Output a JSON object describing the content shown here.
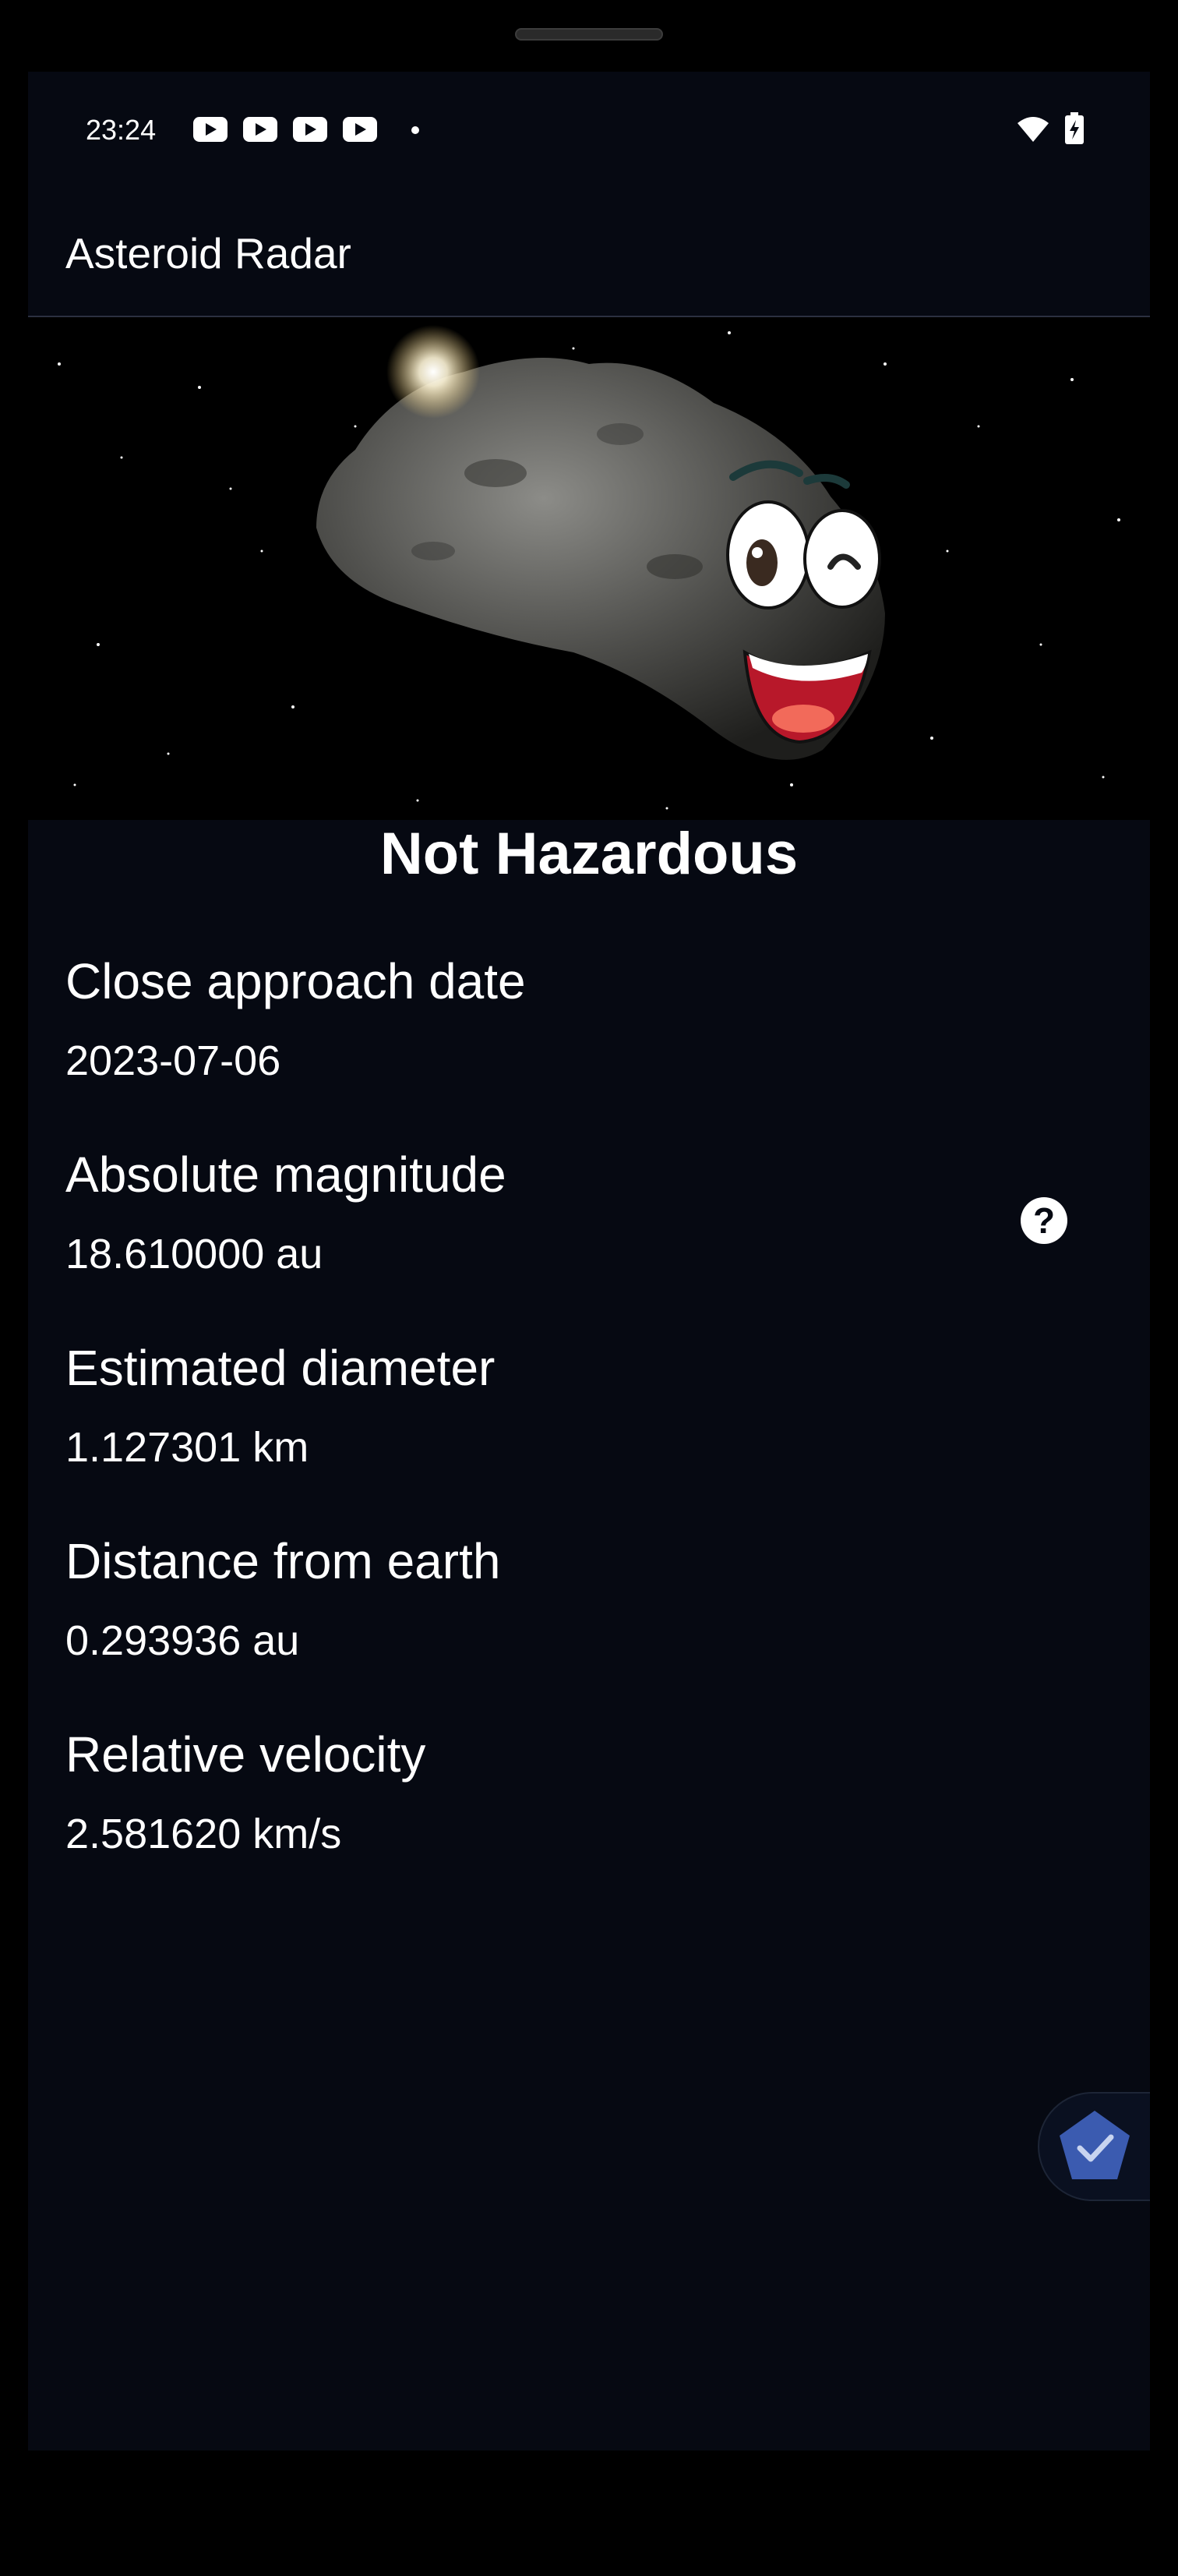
{
  "status": {
    "time": "23:24"
  },
  "appbar": {
    "title": "Asteroid Radar"
  },
  "hero": {
    "image": "smiling-asteroid-in-space"
  },
  "hazard": {
    "text": "Not Hazardous"
  },
  "details": [
    {
      "label": "Close approach date",
      "value": "2023-07-06"
    },
    {
      "label": "Absolute magnitude",
      "value": "18.610000 au"
    },
    {
      "label": "Estimated diameter",
      "value": "1.127301 km"
    },
    {
      "label": "Distance from earth",
      "value": "0.293936 au"
    },
    {
      "label": "Relative velocity",
      "value": "2.581620 km/s"
    }
  ],
  "help_icon": {
    "glyph": "?"
  },
  "colors": {
    "background": "#060912",
    "fab": "#3b5bb0"
  }
}
